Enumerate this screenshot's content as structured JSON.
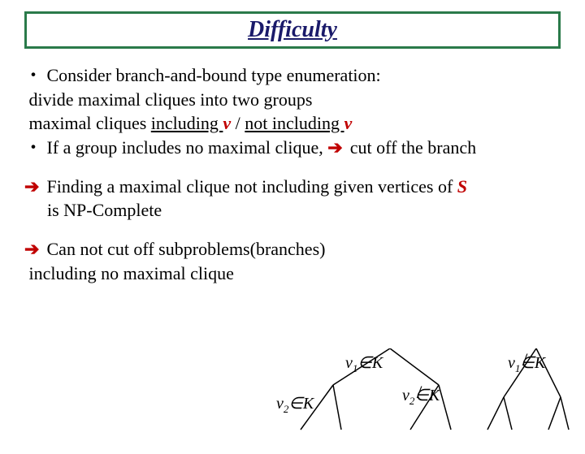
{
  "title": "Difficulty",
  "line1_prefix": "・ Consider branch-and-bound type enumeration:",
  "line2": "divide maximal cliques into two groups",
  "line3_a": "maximal cliques ",
  "line3_including": "including ",
  "line3_v1": "v",
  "line3_sep": " / ",
  "line3_not": "not including ",
  "line3_v2": "v",
  "line4_prefix": "・ If a group includes no maximal clique, ",
  "line4_arrow": "➔",
  "line4_suffix": " cut off the branch",
  "line5_arrow": "➔",
  "line5_a": " Finding a maximal clique not including given vertices of ",
  "line5_S": "S",
  "line5_b": "is NP-Complete",
  "line6_arrow": "➔",
  "line6_a": " Can not cut off subproblems(branches)",
  "line6_b": "including no maximal clique",
  "labels": {
    "v1inK_pre": "v",
    "v1inK_sub": "1",
    "v1inK_rel": "∈",
    "v1inK_post": "K",
    "v1notK_pre": "v",
    "v1notK_sub": "1",
    "v1notK_relbase": "∈",
    "v1notK_post": "K",
    "v2inK_pre": "v",
    "v2inK_sub": "2",
    "v2inK_rel": "∈",
    "v2inK_post": "K",
    "v2notK_pre": "v",
    "v2notK_sub": "2",
    "v2notK_relbase": "∈",
    "v2notK_post": "K"
  }
}
